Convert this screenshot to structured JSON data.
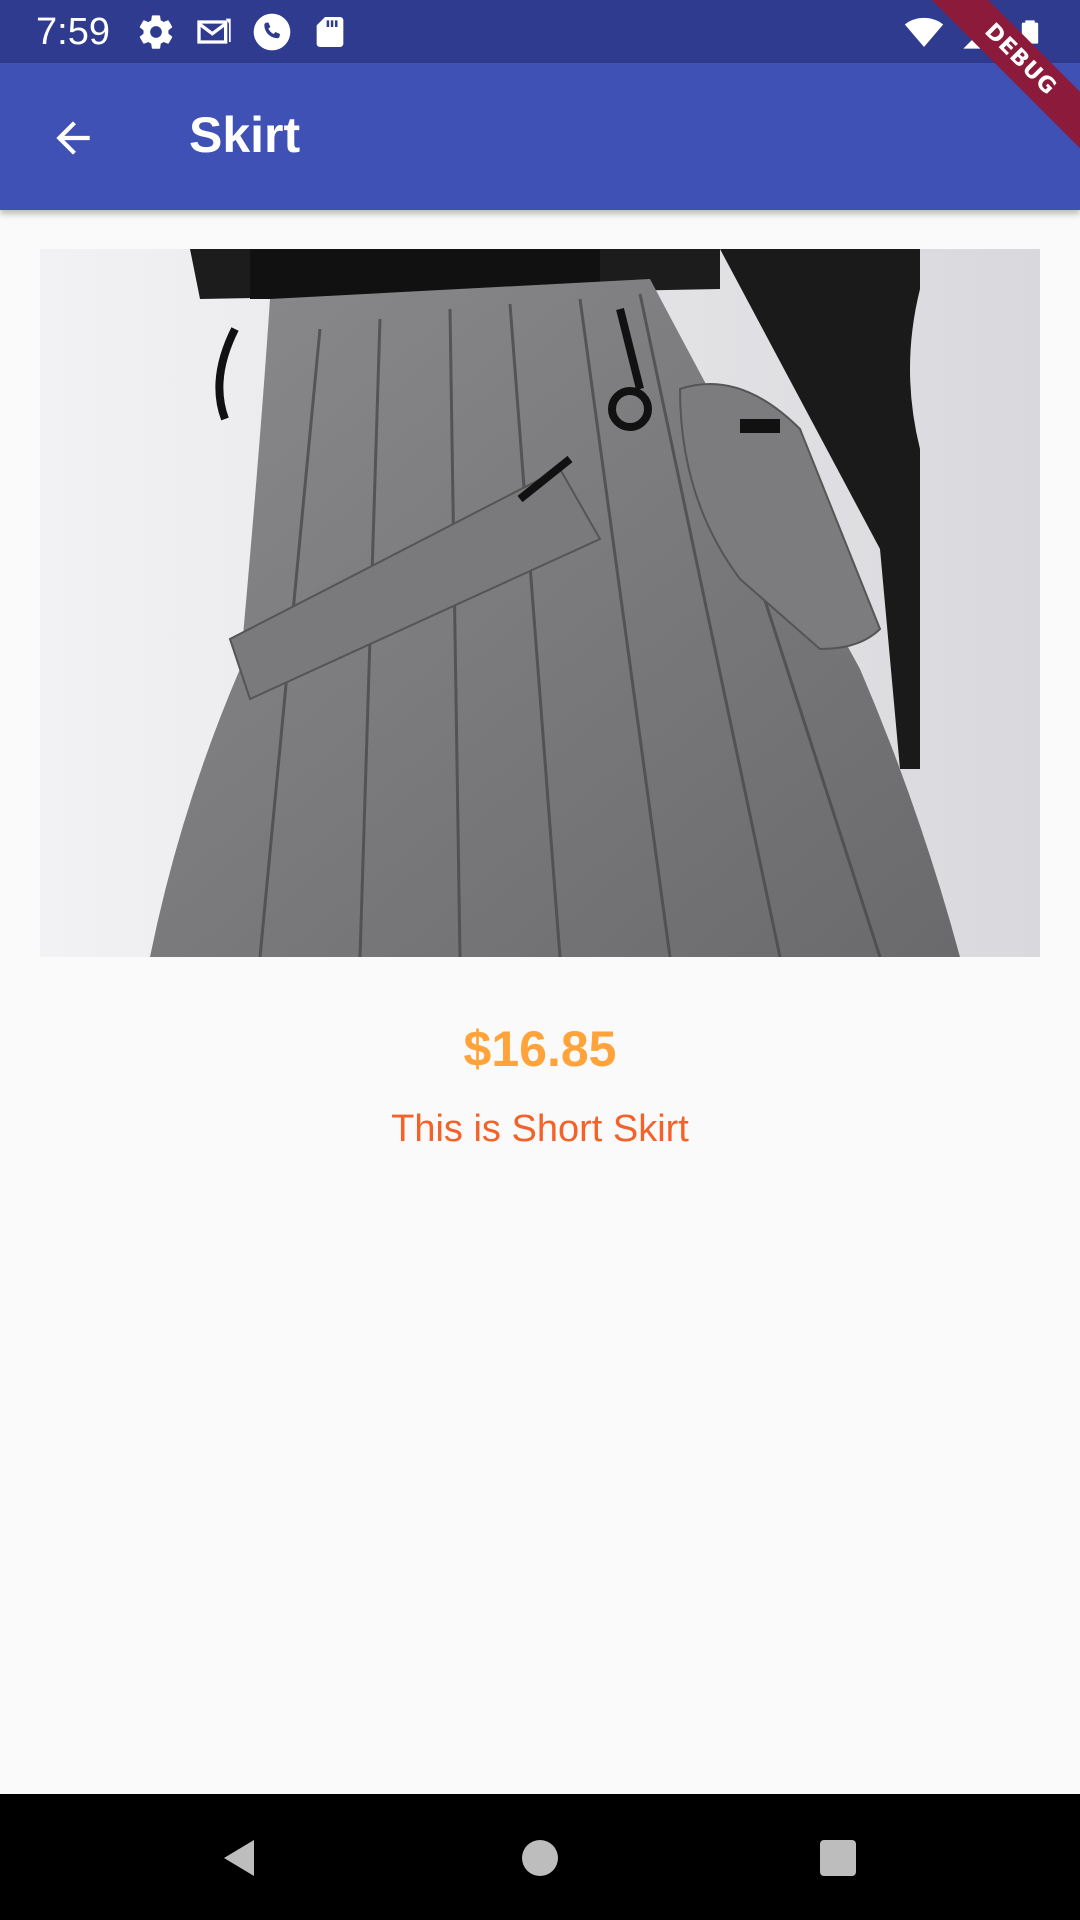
{
  "status_bar": {
    "time": "7:59",
    "icons_left": [
      "settings-icon",
      "gmail-icon",
      "phone-icon",
      "sd-card-icon"
    ],
    "icons_right": [
      "wifi-icon",
      "signal-icon",
      "battery-icon"
    ]
  },
  "app_bar": {
    "title": "Skirt",
    "back_icon": "arrow-back-icon",
    "color": "#3f51b5"
  },
  "debug_banner": {
    "label": "DEBUG"
  },
  "product": {
    "image": "grey-pleated-skirt-photo",
    "price": "$16.85",
    "description": "This is Short Skirt",
    "price_color": "#ffa33a",
    "description_color": "#f4622a"
  },
  "nav_bar": {
    "buttons": [
      "back-triangle-icon",
      "home-circle-icon",
      "recents-square-icon"
    ]
  }
}
